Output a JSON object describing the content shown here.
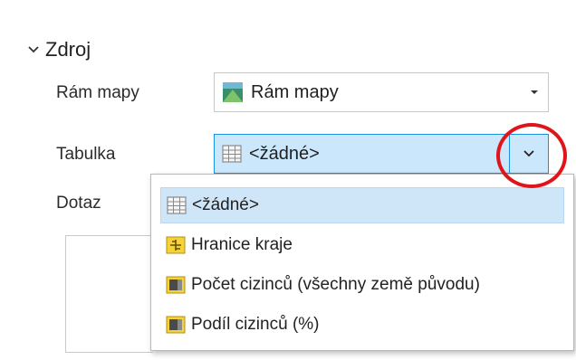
{
  "section": {
    "title": "Zdroj"
  },
  "fields": {
    "map_frame_label": "Rám mapy",
    "map_frame_value": "Rám mapy",
    "table_label": "Tabulka",
    "table_value": "<žádné>",
    "query_label": "Dotaz"
  },
  "dropdown": {
    "options": [
      {
        "label": "<žádné>",
        "icon": "table-icon",
        "selected": true
      },
      {
        "label": "Hranice kraje",
        "icon": "polygon-layer-icon",
        "selected": false
      },
      {
        "label": "Počet cizinců (všechny země původu)",
        "icon": "layer-group-icon",
        "selected": false
      },
      {
        "label": "Podíl cizinců (%)",
        "icon": "layer-group-icon",
        "selected": false
      }
    ]
  },
  "colors": {
    "accent": "#1b8fe0",
    "highlight": "#cfe5f8",
    "annotation_red": "#e0151c"
  }
}
